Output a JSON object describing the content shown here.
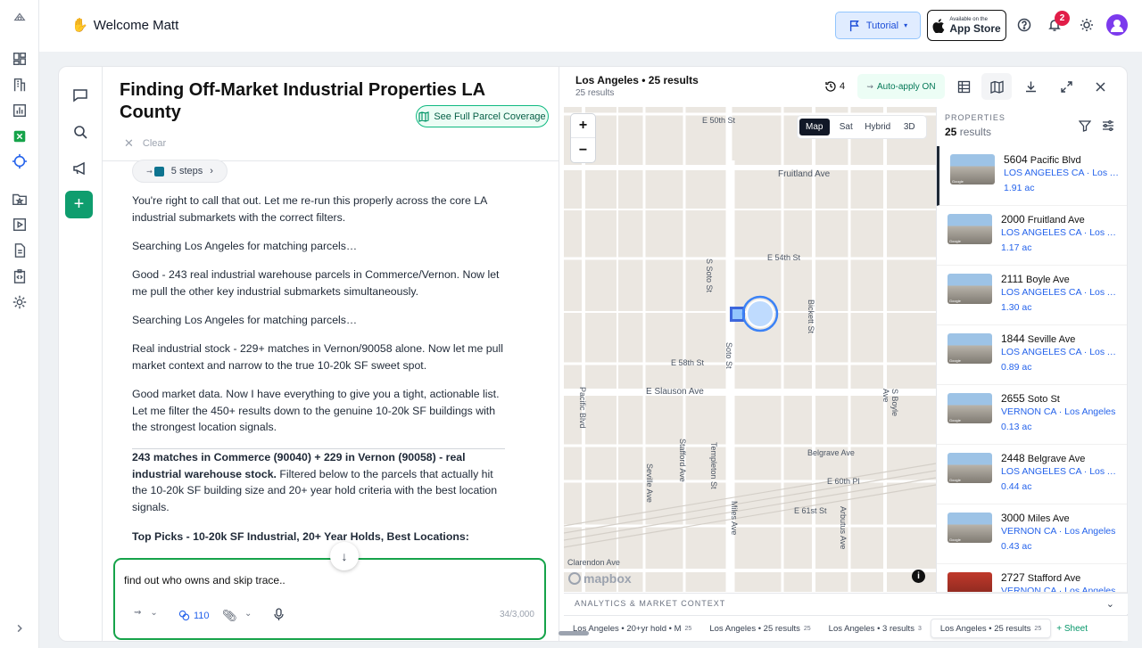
{
  "header": {
    "welcome": "Welcome Matt",
    "tutorial_label": "Tutorial",
    "appstore_small": "Available on the",
    "appstore_big": "App Store",
    "notification_count": "2"
  },
  "chat": {
    "title": "Finding Off-Market Industrial Properties LA County",
    "parcel_button": "See Full Parcel Coverage",
    "clear_label": "Clear",
    "steps_label": "5 steps",
    "messages": [
      "You're right to call that out. Let me re-run this properly across the core LA industrial submarkets with the correct filters.",
      "Searching Los Angeles for matching parcels…",
      "Good - 243 real industrial warehouse parcels in Commerce/Vernon. Now let me pull the other key industrial submarkets simultaneously.",
      "Searching Los Angeles for matching parcels…",
      "Real industrial stock - 229+ matches in Vernon/90058 alone. Now let me pull market context and narrow to the true 10-20k SF sweet spot.",
      "Good market data. Now I have everything to give you a tight, actionable list. Let me filter the 450+ results down to the genuine 10-20k SF buildings with the strongest location signals."
    ],
    "summary_bold": "243 matches in Commerce (90040) + 229 in Vernon (90058) - real industrial warehouse stock.",
    "summary_rest": " Filtered below to the parcels that actually hit the 10-20k SF building size and 20+ year hold criteria with the best location signals.",
    "top_picks": "Top Picks - 10-20k SF Industrial, 20+ Year Holds, Best Locations:",
    "composer_text": "find out who owns and skip trace..",
    "credits": "110",
    "char_count": "34/3,000"
  },
  "map_panel": {
    "title": "Los Angeles • 25 results",
    "subtitle": "25 results",
    "history_count": "4",
    "auto_apply": "Auto-apply ON",
    "map_types": [
      "Map",
      "Sat",
      "Hybrid",
      "3D"
    ],
    "selected_map_type": "Map",
    "streets": [
      "E 50th St",
      "Fruitland Ave",
      "S Soto St",
      "E 54th St",
      "Bickett St",
      "E 58th St",
      "Soto St",
      "E Slauson Ave",
      "Pacific Blvd",
      "S Boyle Ave",
      "Stafford Ave",
      "Templeton St",
      "Seville Ave",
      "Belgrave Ave",
      "E 60th Pl",
      "E 61st St",
      "Miles Ave",
      "Arbutus Ave",
      "Clarendon Ave"
    ],
    "mapbox_label": "mapbox",
    "properties_label": "PROPERTIES",
    "properties_count": "25",
    "properties_suffix": "results",
    "properties": [
      {
        "num": "5604",
        "street": "Pacific Blvd",
        "city": "LOS ANGELES CA · Los Angeles",
        "acres": "1.91 ac"
      },
      {
        "num": "2000",
        "street": "Fruitland Ave",
        "city": "LOS ANGELES CA · Los Angeles",
        "acres": "1.17 ac"
      },
      {
        "num": "2111",
        "street": "Boyle Ave",
        "city": "LOS ANGELES CA · Los Angeles",
        "acres": "1.30 ac"
      },
      {
        "num": "1844",
        "street": "Seville Ave",
        "city": "LOS ANGELES CA · Los Angeles",
        "acres": "0.89 ac"
      },
      {
        "num": "2655",
        "street": "Soto St",
        "city": "VERNON CA · Los Angeles",
        "acres": "0.13 ac"
      },
      {
        "num": "2448",
        "street": "Belgrave Ave",
        "city": "LOS ANGELES CA · Los Angeles",
        "acres": "0.44 ac"
      },
      {
        "num": "3000",
        "street": "Miles Ave",
        "city": "VERNON CA · Los Angeles",
        "acres": "0.43 ac"
      },
      {
        "num": "2727",
        "street": "Stafford Ave",
        "city": "VERNON CA · Los Angeles",
        "acres": ""
      }
    ],
    "analytics_label": "ANALYTICS & MARKET CONTEXT",
    "tabs": [
      {
        "label": "Los Angeles • 20+yr hold • M",
        "count": "25"
      },
      {
        "label": "Los Angeles • 25 results",
        "count": "25"
      },
      {
        "label": "Los Angeles • 3 results",
        "count": "3"
      },
      {
        "label": "Los Angeles • 25 results",
        "count": "25"
      }
    ],
    "add_sheet": "+ Sheet"
  },
  "colors": {
    "accent_green": "#16a34a",
    "link_blue": "#2563eb",
    "badge_red": "#e11d48"
  }
}
